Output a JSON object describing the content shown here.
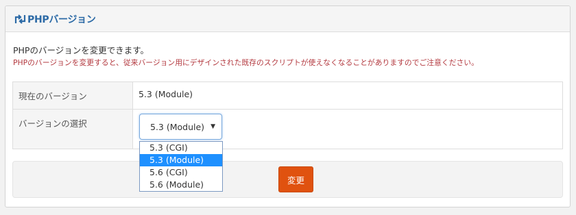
{
  "panel": {
    "title": "PHPバージョン",
    "icon": "refresh-arrows-icon"
  },
  "description": "PHPのバージョンを変更できます。",
  "warning": "PHPのバージョンを変更すると、従来バージョン用にデザインされた既存のスクリプトが使えなくなることがありますのでご注意ください。",
  "table": {
    "current_label": "現在のバージョン",
    "current_value": "5.3 (Module)",
    "select_label": "バージョンの選択"
  },
  "select": {
    "value": "5.3 (Module)",
    "arrow": "▼",
    "options": [
      "5.3 (CGI)",
      "5.3 (Module)",
      "5.6 (CGI)",
      "5.6 (Module)"
    ],
    "highlighted": "5.3 (Module)"
  },
  "buttons": {
    "change": "変更"
  },
  "colors": {
    "title": "#2c6aa6",
    "warning": "#b3393f",
    "button": "#e0520f",
    "highlight": "#1e90ff"
  }
}
